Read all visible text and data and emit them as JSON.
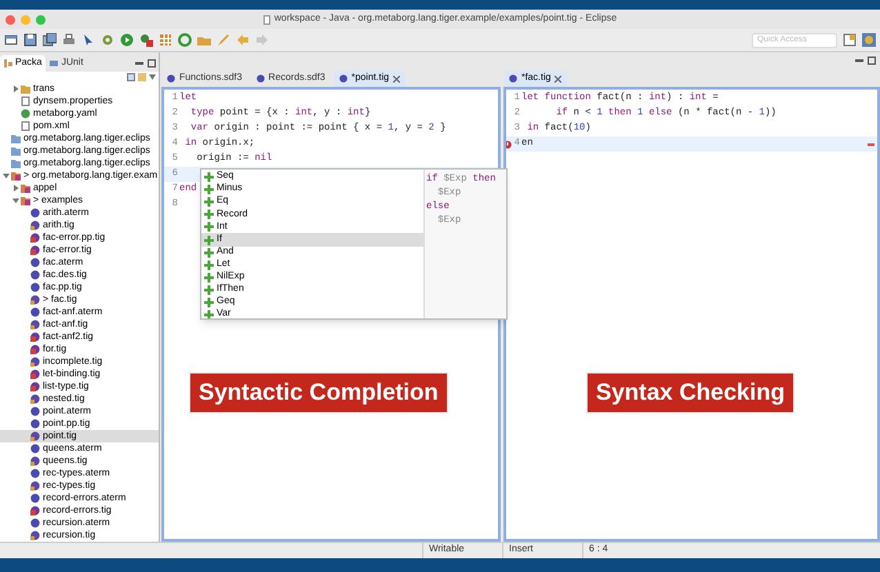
{
  "window": {
    "title": "workspace - Java - org.metaborg.lang.tiger.example/examples/point.tig - Eclipse"
  },
  "toolbar": {
    "quick_access": {
      "placeholder": "Quick Access"
    }
  },
  "explorer": {
    "tabs": [
      {
        "label": "Packa",
        "selected": true
      },
      {
        "label": "JUnit",
        "selected": false
      }
    ],
    "partial_children": [
      {
        "label": "trans",
        "kind": "folder",
        "expanded": false
      },
      {
        "label": "dynsem.properties",
        "kind": "file"
      },
      {
        "label": "metaborg.yaml",
        "kind": "yaml"
      },
      {
        "label": "pom.xml",
        "kind": "file"
      }
    ],
    "tree": [
      {
        "label": "org.metaborg.lang.tiger.eclips",
        "kind": "project"
      },
      {
        "label": "org.metaborg.lang.tiger.eclips",
        "kind": "project"
      },
      {
        "label": "org.metaborg.lang.tiger.eclips",
        "kind": "project"
      },
      {
        "label": "> org.metaborg.lang.tiger.exam",
        "kind": "package",
        "expanded": true,
        "children": [
          {
            "label": "appel",
            "kind": "package",
            "expanded": false
          },
          {
            "label": "> examples",
            "kind": "package",
            "expanded": true,
            "children": [
              {
                "label": "arith.aterm",
                "kind": "aterm"
              },
              {
                "label": "arith.tig",
                "kind": "tig"
              },
              {
                "label": "fac-error.pp.tig",
                "kind": "tig-error"
              },
              {
                "label": "fac-error.tig",
                "kind": "tig-error"
              },
              {
                "label": "fac.aterm",
                "kind": "aterm"
              },
              {
                "label": "fac.des.tig",
                "kind": "aterm"
              },
              {
                "label": "fac.pp.tig",
                "kind": "aterm"
              },
              {
                "label": "> fac.tig",
                "kind": "tig"
              },
              {
                "label": "fact-anf.aterm",
                "kind": "aterm"
              },
              {
                "label": "fact-anf.tig",
                "kind": "tig"
              },
              {
                "label": "fact-anf2.tig",
                "kind": "tig-error"
              },
              {
                "label": "for.tig",
                "kind": "tig-error"
              },
              {
                "label": "incomplete.tig",
                "kind": "tig"
              },
              {
                "label": "let-binding.tig",
                "kind": "tig-error"
              },
              {
                "label": "list-type.tig",
                "kind": "tig-error"
              },
              {
                "label": "nested.tig",
                "kind": "tig"
              },
              {
                "label": "point.aterm",
                "kind": "aterm"
              },
              {
                "label": "point.pp.tig",
                "kind": "aterm"
              },
              {
                "label": "point.tig",
                "kind": "tig",
                "selected": true
              },
              {
                "label": "queens.aterm",
                "kind": "aterm"
              },
              {
                "label": "queens.tig",
                "kind": "tig"
              },
              {
                "label": "rec-types.aterm",
                "kind": "aterm"
              },
              {
                "label": "rec-types.tig",
                "kind": "tig"
              },
              {
                "label": "record-errors.aterm",
                "kind": "aterm"
              },
              {
                "label": "record-errors.tig",
                "kind": "tig-error"
              },
              {
                "label": "recursion.aterm",
                "kind": "aterm"
              },
              {
                "label": "recursion.tig",
                "kind": "tig"
              }
            ]
          }
        ]
      }
    ]
  },
  "editors": [
    {
      "tabs": [
        {
          "label": "Functions.sdf3",
          "selected": false
        },
        {
          "label": "Records.sdf3",
          "selected": false
        },
        {
          "label": "*point.tig",
          "selected": true
        }
      ],
      "lines": [
        {
          "n": "1",
          "current": false,
          "segments": [
            {
              "t": "let",
              "kind": "keyword"
            }
          ]
        },
        {
          "n": "2",
          "current": false,
          "segments": [
            {
              "t": "  type",
              "kind": "keyword"
            },
            {
              "t": " point = {x : ",
              "kind": "plain"
            },
            {
              "t": "int",
              "kind": "keyword"
            },
            {
              "t": ", y : ",
              "kind": "plain"
            },
            {
              "t": "int",
              "kind": "keyword"
            },
            {
              "t": "}",
              "kind": "plain"
            }
          ]
        },
        {
          "n": "3",
          "current": false,
          "segments": [
            {
              "t": "  var",
              "kind": "keyword"
            },
            {
              "t": " origin : point := point { x = ",
              "kind": "plain"
            },
            {
              "t": "1",
              "kind": "number"
            },
            {
              "t": ", y = ",
              "kind": "plain"
            },
            {
              "t": "2",
              "kind": "number"
            },
            {
              "t": " }",
              "kind": "plain"
            }
          ]
        },
        {
          "n": "4",
          "current": false,
          "segments": [
            {
              "t": " in",
              "kind": "keyword"
            },
            {
              "t": " origin.x;",
              "kind": "plain"
            }
          ]
        },
        {
          "n": "5",
          "current": false,
          "segments": [
            {
              "t": "   origin := ",
              "kind": "plain"
            },
            {
              "t": "nil",
              "kind": "keyword"
            }
          ]
        },
        {
          "n": "6",
          "current": true
        },
        {
          "n": "7",
          "current": false,
          "segments": [
            {
              "t": "end",
              "kind": "keyword"
            }
          ]
        },
        {
          "n": "8",
          "current": false
        }
      ],
      "label": "Syntactic Completion"
    },
    {
      "tabs": [
        {
          "label": "*fac.tig",
          "selected": true
        }
      ],
      "lines": [
        {
          "n": "1",
          "current": false,
          "segments": [
            {
              "t": "let",
              "kind": "keyword"
            },
            {
              "t": " function",
              "kind": "keyword"
            },
            {
              "t": " fact(n : ",
              "kind": "plain"
            },
            {
              "t": "int",
              "kind": "keyword"
            },
            {
              "t": ") : ",
              "kind": "plain"
            },
            {
              "t": "int",
              "kind": "keyword"
            },
            {
              "t": " =",
              "kind": "plain"
            }
          ]
        },
        {
          "n": "2",
          "current": false,
          "segments": [
            {
              "t": "      if",
              "kind": "keyword"
            },
            {
              "t": " n < ",
              "kind": "plain"
            },
            {
              "t": "1",
              "kind": "number"
            },
            {
              "t": " then",
              "kind": "keyword"
            },
            {
              "t": " 1",
              "kind": "number"
            },
            {
              "t": " else",
              "kind": "keyword"
            },
            {
              "t": " (n * fact(n - ",
              "kind": "plain"
            },
            {
              "t": "1",
              "kind": "number"
            },
            {
              "t": "))",
              "kind": "plain"
            }
          ]
        },
        {
          "n": "3",
          "current": false,
          "segments": [
            {
              "t": " in",
              "kind": "keyword"
            },
            {
              "t": " fact(",
              "kind": "plain"
            },
            {
              "t": "10",
              "kind": "number"
            },
            {
              "t": ")",
              "kind": "plain"
            }
          ]
        },
        {
          "n": "4",
          "current": true,
          "error": true,
          "segments": [
            {
              "t": "en",
              "kind": "plain"
            }
          ]
        }
      ],
      "label": "Syntax Checking"
    }
  ],
  "completion": {
    "items": [
      {
        "label": "Seq",
        "selected": false
      },
      {
        "label": "Minus",
        "selected": false
      },
      {
        "label": "Eq",
        "selected": false
      },
      {
        "label": "Record",
        "selected": false
      },
      {
        "label": "Int",
        "selected": false
      },
      {
        "label": "If",
        "selected": true
      },
      {
        "label": "And",
        "selected": false
      },
      {
        "label": "Let",
        "selected": false
      },
      {
        "label": "NilExp",
        "selected": false
      },
      {
        "label": "IfThen",
        "selected": false
      },
      {
        "label": "Geq",
        "selected": false
      },
      {
        "label": "Var",
        "selected": false
      }
    ],
    "preview": [
      [
        {
          "t": "if",
          "kind": "keyword"
        },
        {
          "t": " $Exp ",
          "kind": "placeholder"
        },
        {
          "t": "then",
          "kind": "keyword"
        }
      ],
      [
        {
          "t": "  $Exp",
          "kind": "placeholder"
        }
      ],
      [
        {
          "t": "else",
          "kind": "keyword"
        }
      ],
      [
        {
          "t": "  $Exp",
          "kind": "placeholder"
        }
      ]
    ]
  },
  "status_bar": [
    "Writable",
    "Insert",
    "6 : 4"
  ]
}
